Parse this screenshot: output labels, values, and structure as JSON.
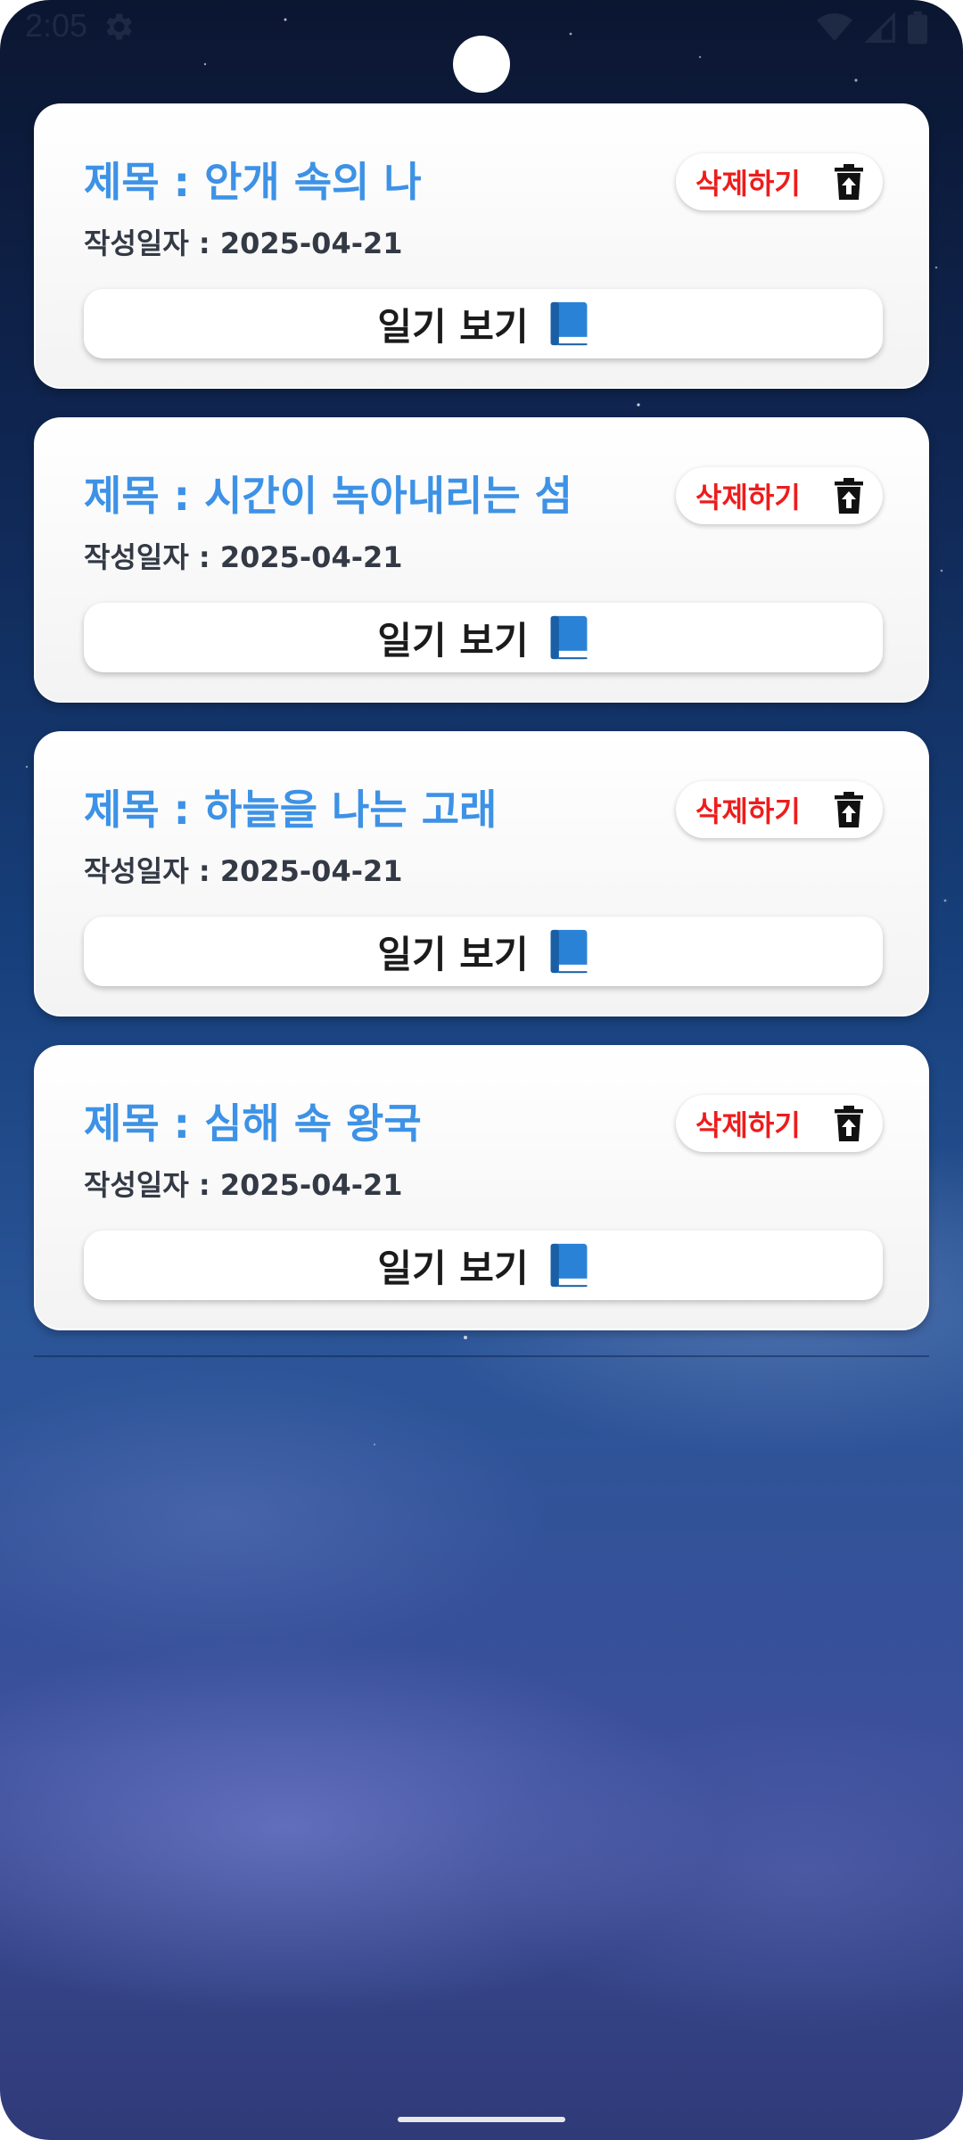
{
  "status_bar": {
    "time": "2:05",
    "icons": [
      "settings-gear-icon",
      "wifi-icon",
      "cellular-signal-icon",
      "battery-icon"
    ]
  },
  "diaries": [
    {
      "title": "제목 : 안개 속의 나",
      "date": "작성일자 : 2025-04-21",
      "delete_label": "삭제하기",
      "view_label": "일기 보기"
    },
    {
      "title": "제목 : 시간이 녹아내리는 섬",
      "date": "작성일자 : 2025-04-21",
      "delete_label": "삭제하기",
      "view_label": "일기 보기"
    },
    {
      "title": "제목 : 하늘을 나는 고래",
      "date": "작성일자 : 2025-04-21",
      "delete_label": "삭제하기",
      "view_label": "일기 보기"
    },
    {
      "title": "제목 : 심해 속 왕국",
      "date": "작성일자 : 2025-04-21",
      "delete_label": "삭제하기",
      "view_label": "일기 보기"
    }
  ],
  "colors": {
    "title": "#3d92e6",
    "delete": "#ee1c1c",
    "background_top": "#0b1631",
    "background_bottom": "#3c4f9a"
  }
}
